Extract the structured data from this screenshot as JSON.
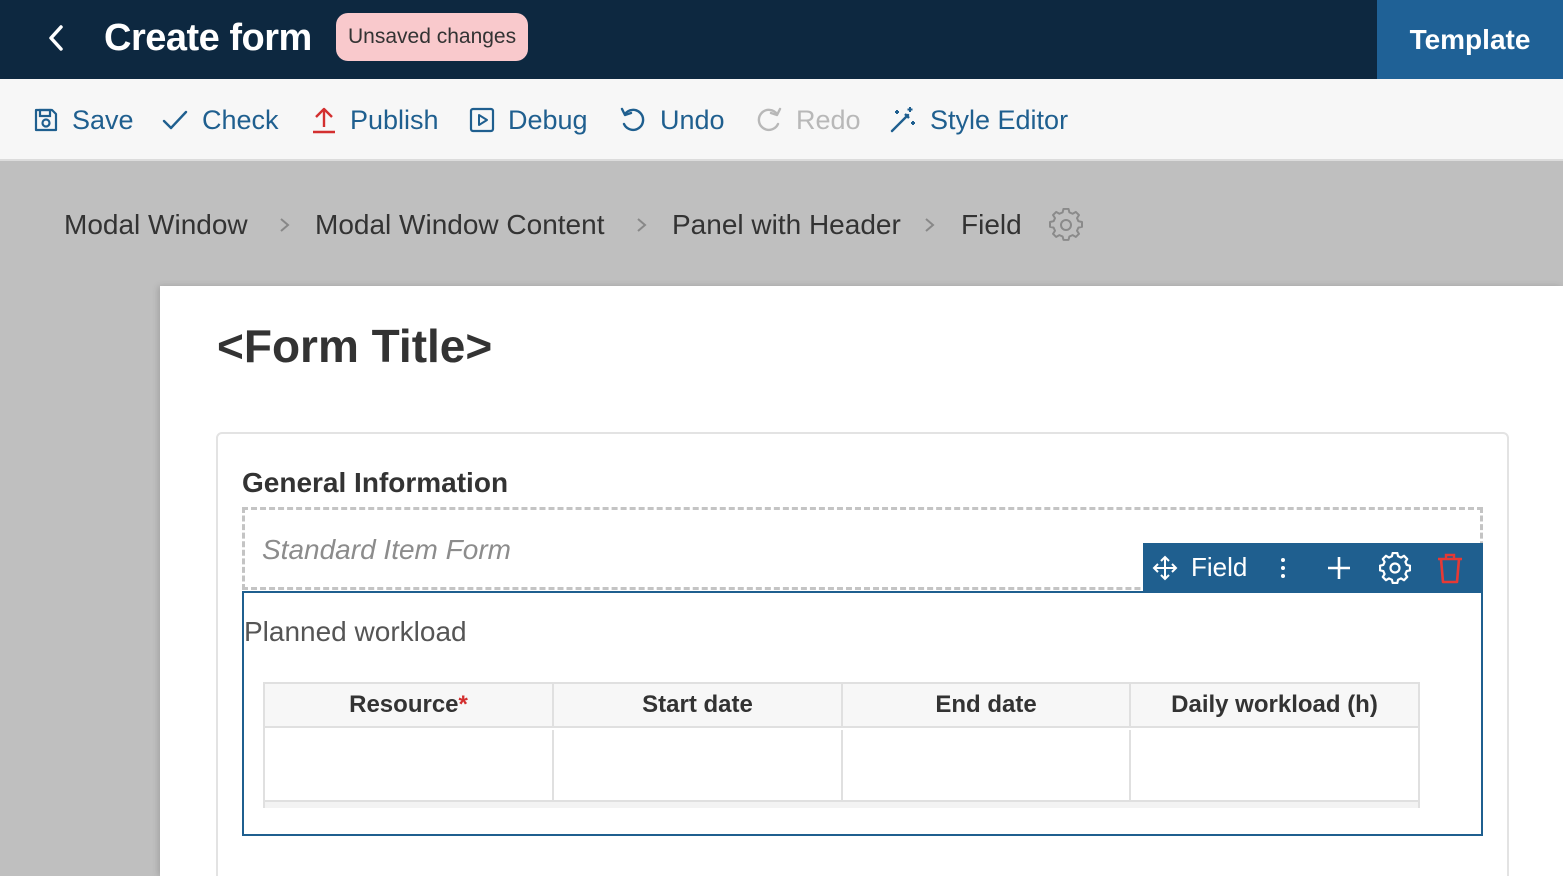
{
  "header": {
    "title": "Create form",
    "badge": "Unsaved changes",
    "template_button": "Template",
    "colors": {
      "bar": "#0d2840",
      "template": "#1f6196",
      "badge": "#f9c9cc"
    }
  },
  "toolbar": {
    "save": "Save",
    "check": "Check",
    "publish": "Publish",
    "debug": "Debug",
    "undo": "Undo",
    "redo": "Redo",
    "style_editor": "Style Editor",
    "accent": "#1f5f8f"
  },
  "breadcrumb": [
    "Modal Window",
    "Modal Window Content",
    "Panel with Header",
    "Field"
  ],
  "form": {
    "title": "<Form Title>",
    "panel_header": "General Information",
    "placeholder": "Standard Item Form",
    "field_label": "Planned workload",
    "field_toolbar_label": "Field",
    "table": {
      "columns": [
        "Resource",
        "Start date",
        "End date",
        "Daily workload (h)"
      ],
      "required_marker": "*"
    }
  }
}
